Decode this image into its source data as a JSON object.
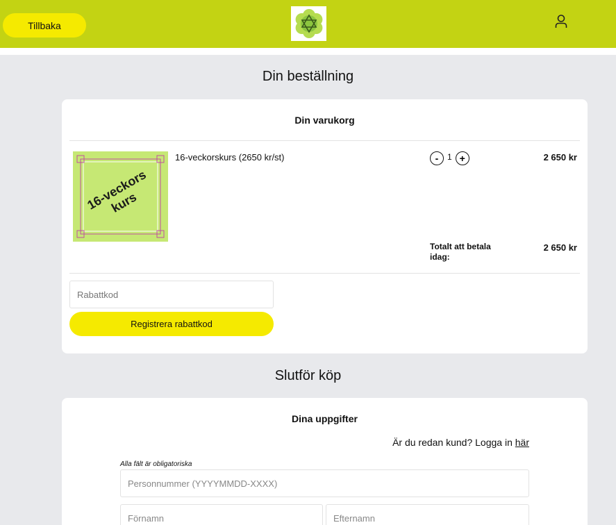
{
  "header": {
    "back_label": "Tillbaka",
    "logo_icon": "star-of-david-mandala-icon",
    "user_icon": "user-icon",
    "bg_color": "#c3d313",
    "button_color": "#f5ea00"
  },
  "order": {
    "title": "Din beställning",
    "cart_title": "Din varukorg",
    "product": {
      "image_text_line1": "16-veckors",
      "image_text_line2": "kurs",
      "name": "16-veckorskurs (2650 kr/st)",
      "decrement": "-",
      "quantity": "1",
      "increment": "+",
      "price": "2 650 kr"
    },
    "total_label": "Totalt att betala idag:",
    "total_value": "2 650 kr",
    "discount_placeholder": "Rabattkod",
    "discount_button": "Registrera rabattkod"
  },
  "checkout": {
    "title": "Slutför köp",
    "details_title": "Dina uppgifter",
    "login_prompt": "Är du redan kund? Logga in",
    "login_link": "här",
    "required_note": "Alla fält är obligatoriska",
    "personnummer_placeholder": "Personnummer (YYYYMMDD-XXXX)",
    "firstname_placeholder": "Förnamn",
    "lastname_placeholder": "Efternamn"
  }
}
